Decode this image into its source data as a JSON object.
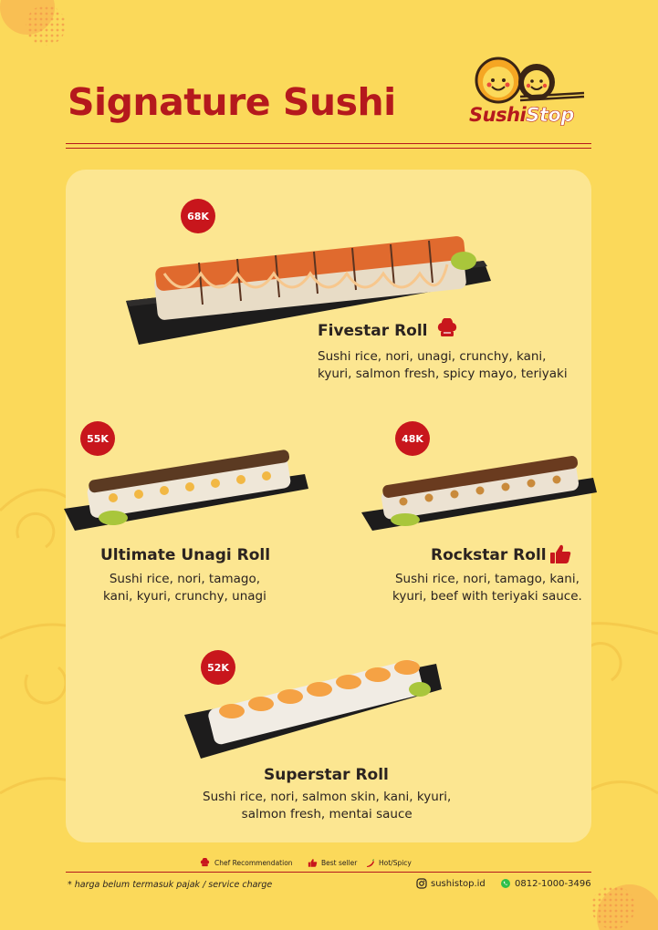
{
  "menu": {
    "title": "Signature Sushi",
    "brand": {
      "part1": "Sushi",
      "part2": "Stop"
    },
    "items": [
      {
        "name": "Fivestar Roll",
        "price": "68K",
        "badge": "chef-hat-icon",
        "desc_lines": [
          "Sushi rice, nori, unagi, crunchy, kani,",
          "kyuri, salmon fresh, spicy mayo, teriyaki"
        ]
      },
      {
        "name": "Ultimate Unagi Roll",
        "price": "55K",
        "desc_lines": [
          "Sushi rice, nori, tamago,",
          "kani, kyuri, crunchy, unagi"
        ]
      },
      {
        "name": "Rockstar Roll",
        "price": "48K",
        "badge": "thumbs-up-icon",
        "desc_lines": [
          "Sushi rice, nori, tamago, kani,",
          "kyuri, beef with teriyaki sauce."
        ]
      },
      {
        "name": "Superstar Roll",
        "price": "52K",
        "desc_lines": [
          "Sushi rice, nori, salmon skin, kani, kyuri,",
          "salmon fresh, mentai sauce"
        ]
      }
    ],
    "legend": [
      {
        "icon": "chef-hat-icon",
        "label": "Chef Recommendation"
      },
      {
        "icon": "thumbs-up-icon",
        "label": "Best seller"
      },
      {
        "icon": "chili-icon",
        "label": "Hot/Spicy"
      }
    ],
    "footnote": "* harga belum termasuk pajak / service charge",
    "instagram": "sushistop.id",
    "whatsapp": "0812-1000-3496"
  },
  "colors": {
    "background": "#fbd95a",
    "panel": "#fce691",
    "accent": "#b5191d",
    "price_badge": "#c8161c",
    "text": "#2b2320"
  }
}
